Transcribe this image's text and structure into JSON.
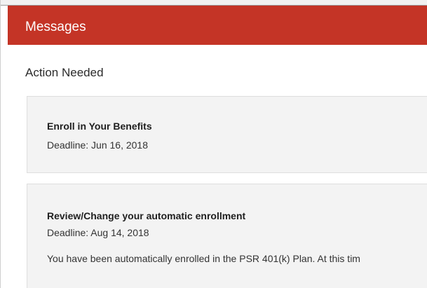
{
  "header": {
    "title": "Messages",
    "background_color": "#c43426"
  },
  "section": {
    "title": "Action Needed"
  },
  "messages": [
    {
      "title": "Enroll in Your Benefits",
      "deadline": "Deadline: Jun 16, 2018"
    },
    {
      "title": "Review/Change your automatic enrollment",
      "deadline": "Deadline: Aug 14, 2018",
      "description": "You have been automatically enrolled in the PSR 401(k) Plan. At this tim"
    }
  ]
}
